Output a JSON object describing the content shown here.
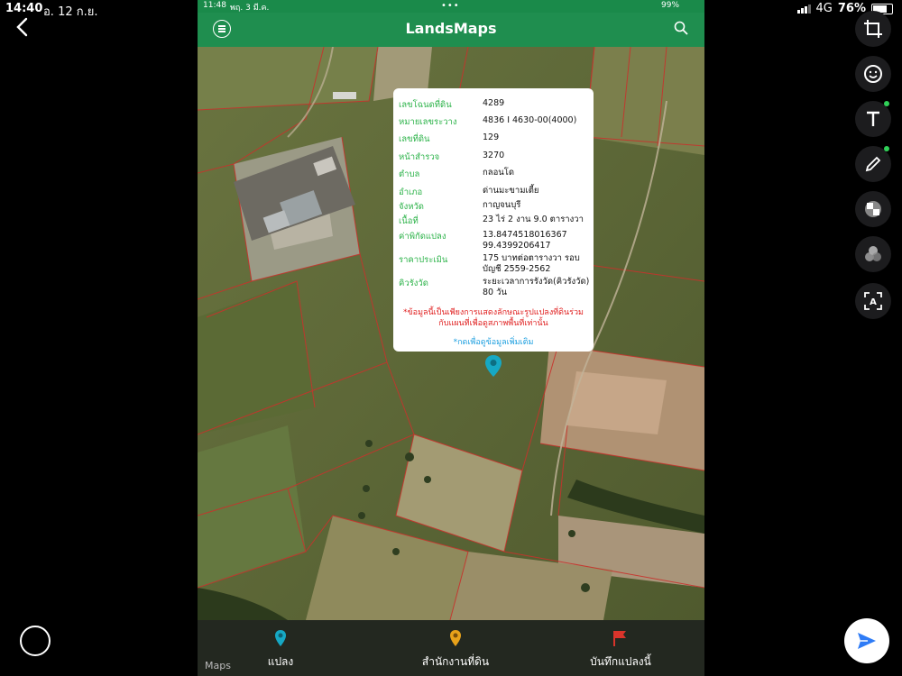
{
  "outer_status": {
    "time": "14:40",
    "date": "อ. 12 ก.ย.",
    "network": "4G",
    "battery": "76%"
  },
  "inner_status": {
    "time": "11:48",
    "date": "พฤ. 3 มี.ค.",
    "battery": "99%"
  },
  "app": {
    "title": "LandsMaps"
  },
  "info": [
    {
      "key": "เลขโฉนดที่ดิน",
      "value": "4289"
    },
    {
      "key": "หมายเลขระวาง",
      "value": "4836 I 4630-00(4000)"
    },
    {
      "key": "เลขที่ดิน",
      "value": "129"
    },
    {
      "key": "หน้าสำรวจ",
      "value": "3270"
    },
    {
      "key": "ตำบล",
      "value": "กลอนโด"
    },
    {
      "key": "อำเภอ",
      "value": "ด่านมะขามเตี้ย"
    },
    {
      "key": "จังหวัด",
      "value": "กาญจนบุรี"
    },
    {
      "key": "เนื้อที่",
      "value": "23 ไร่ 2 งาน 9.0 ตารางวา"
    },
    {
      "key": "ค่าพิกัดแปลง",
      "value": "13.8474518016367\n99.4399206417"
    },
    {
      "key": "ราคาประเมิน",
      "value": "175 บาทต่อตารางวา รอบบัญชี 2559-2562"
    },
    {
      "key": "คิวรังวัด",
      "value": "ระยะเวลาการรังวัด(คิวรังวัด) 80 วัน"
    }
  ],
  "note": "*ข้อมูลนี้เป็นเพียงการแสดงลักษณะรูปแปลงที่ดินร่วมกับแผนที่เพื่อดูสภาพพื้นที่เท่านั้น",
  "more_link": "*กดเพื่อดูข้อมูลเพิ่มเติม",
  "nav": {
    "parcel": "แปลง",
    "land_office": "สำนักงานที่ดิน",
    "save_parcel": "บันทึกแปลงนี้"
  },
  "maps_watermark": "Maps",
  "colors": {
    "app_green": "#1f8e4f",
    "key_green": "#2db34a",
    "note_red": "#e02020",
    "link_blue": "#1fa0e0",
    "pin_cyan": "#16a8c4",
    "office_pin": "#e8a21a",
    "flag_red": "#d9342b"
  }
}
